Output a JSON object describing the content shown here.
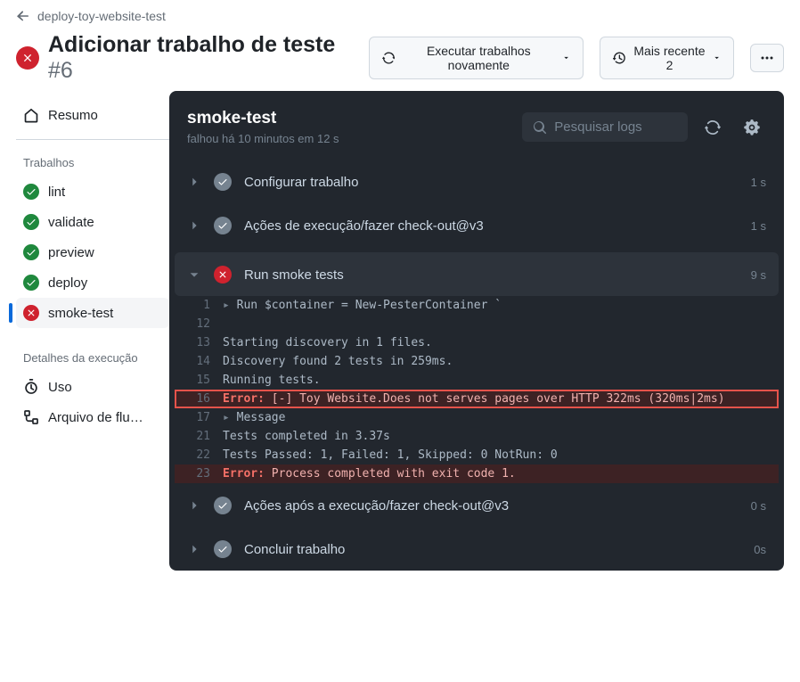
{
  "back_label": "deploy-toy-website-test",
  "run": {
    "title": "Adicionar trabalho de teste",
    "number": "#6"
  },
  "toolbar": {
    "rerun": "Executar trabalhos novamente",
    "latest": "Mais recente 2"
  },
  "sidebar": {
    "summary": "Resumo",
    "jobs_head": "Trabalhos",
    "jobs": [
      {
        "name": "lint",
        "status": "pass"
      },
      {
        "name": "validate",
        "status": "pass"
      },
      {
        "name": "preview",
        "status": "pass"
      },
      {
        "name": "deploy",
        "status": "pass"
      },
      {
        "name": "smoke-test",
        "status": "fail",
        "active": true
      }
    ],
    "details_head": "Detalhes da execução",
    "usage": "Uso",
    "workflow_file": "Arquivo de flu…"
  },
  "panel": {
    "title": "smoke-test",
    "subtitle": "falhou há 10 minutos em 12 s",
    "search_placeholder": "Pesquisar logs"
  },
  "steps": [
    {
      "name": "Configurar trabalho",
      "status": "pass",
      "time": "1 s",
      "expanded": false
    },
    {
      "name": "Ações de execução/fazer check-out@v3",
      "status": "pass",
      "time": "1 s",
      "expanded": false
    },
    {
      "name": "Run smoke tests",
      "status": "fail",
      "time": "9 s",
      "expanded": true
    },
    {
      "name": "Ações após a execução/fazer check-out@v3",
      "status": "pass",
      "time": "0 s",
      "expanded": false
    },
    {
      "name": "Concluir trabalho",
      "status": "pass",
      "time": "0s",
      "expanded": false
    }
  ],
  "log": [
    {
      "n": "1",
      "type": "cmd",
      "text": "Run $container = New-PesterContainer `"
    },
    {
      "n": "12",
      "type": "blank",
      "text": ""
    },
    {
      "n": "13",
      "type": "plain",
      "text": "Starting discovery in 1 files."
    },
    {
      "n": "14",
      "type": "plain",
      "text": "Discovery found 2 tests in 259ms."
    },
    {
      "n": "15",
      "type": "plain",
      "text": "Running tests."
    },
    {
      "n": "16",
      "type": "error_boxed",
      "label": "Error:",
      "text": " [-] Toy Website.Does not serves pages over HTTP 322ms (320ms|2ms)"
    },
    {
      "n": "17",
      "type": "cmd",
      "text": "Message"
    },
    {
      "n": "21",
      "type": "plain",
      "text": "Tests completed in 3.37s"
    },
    {
      "n": "22",
      "type": "plain",
      "text": "Tests Passed: 1, Failed: 1, Skipped: 0 NotRun: 0"
    },
    {
      "n": "23",
      "type": "error",
      "label": "Error:",
      "text": " Process completed with exit code 1."
    }
  ]
}
